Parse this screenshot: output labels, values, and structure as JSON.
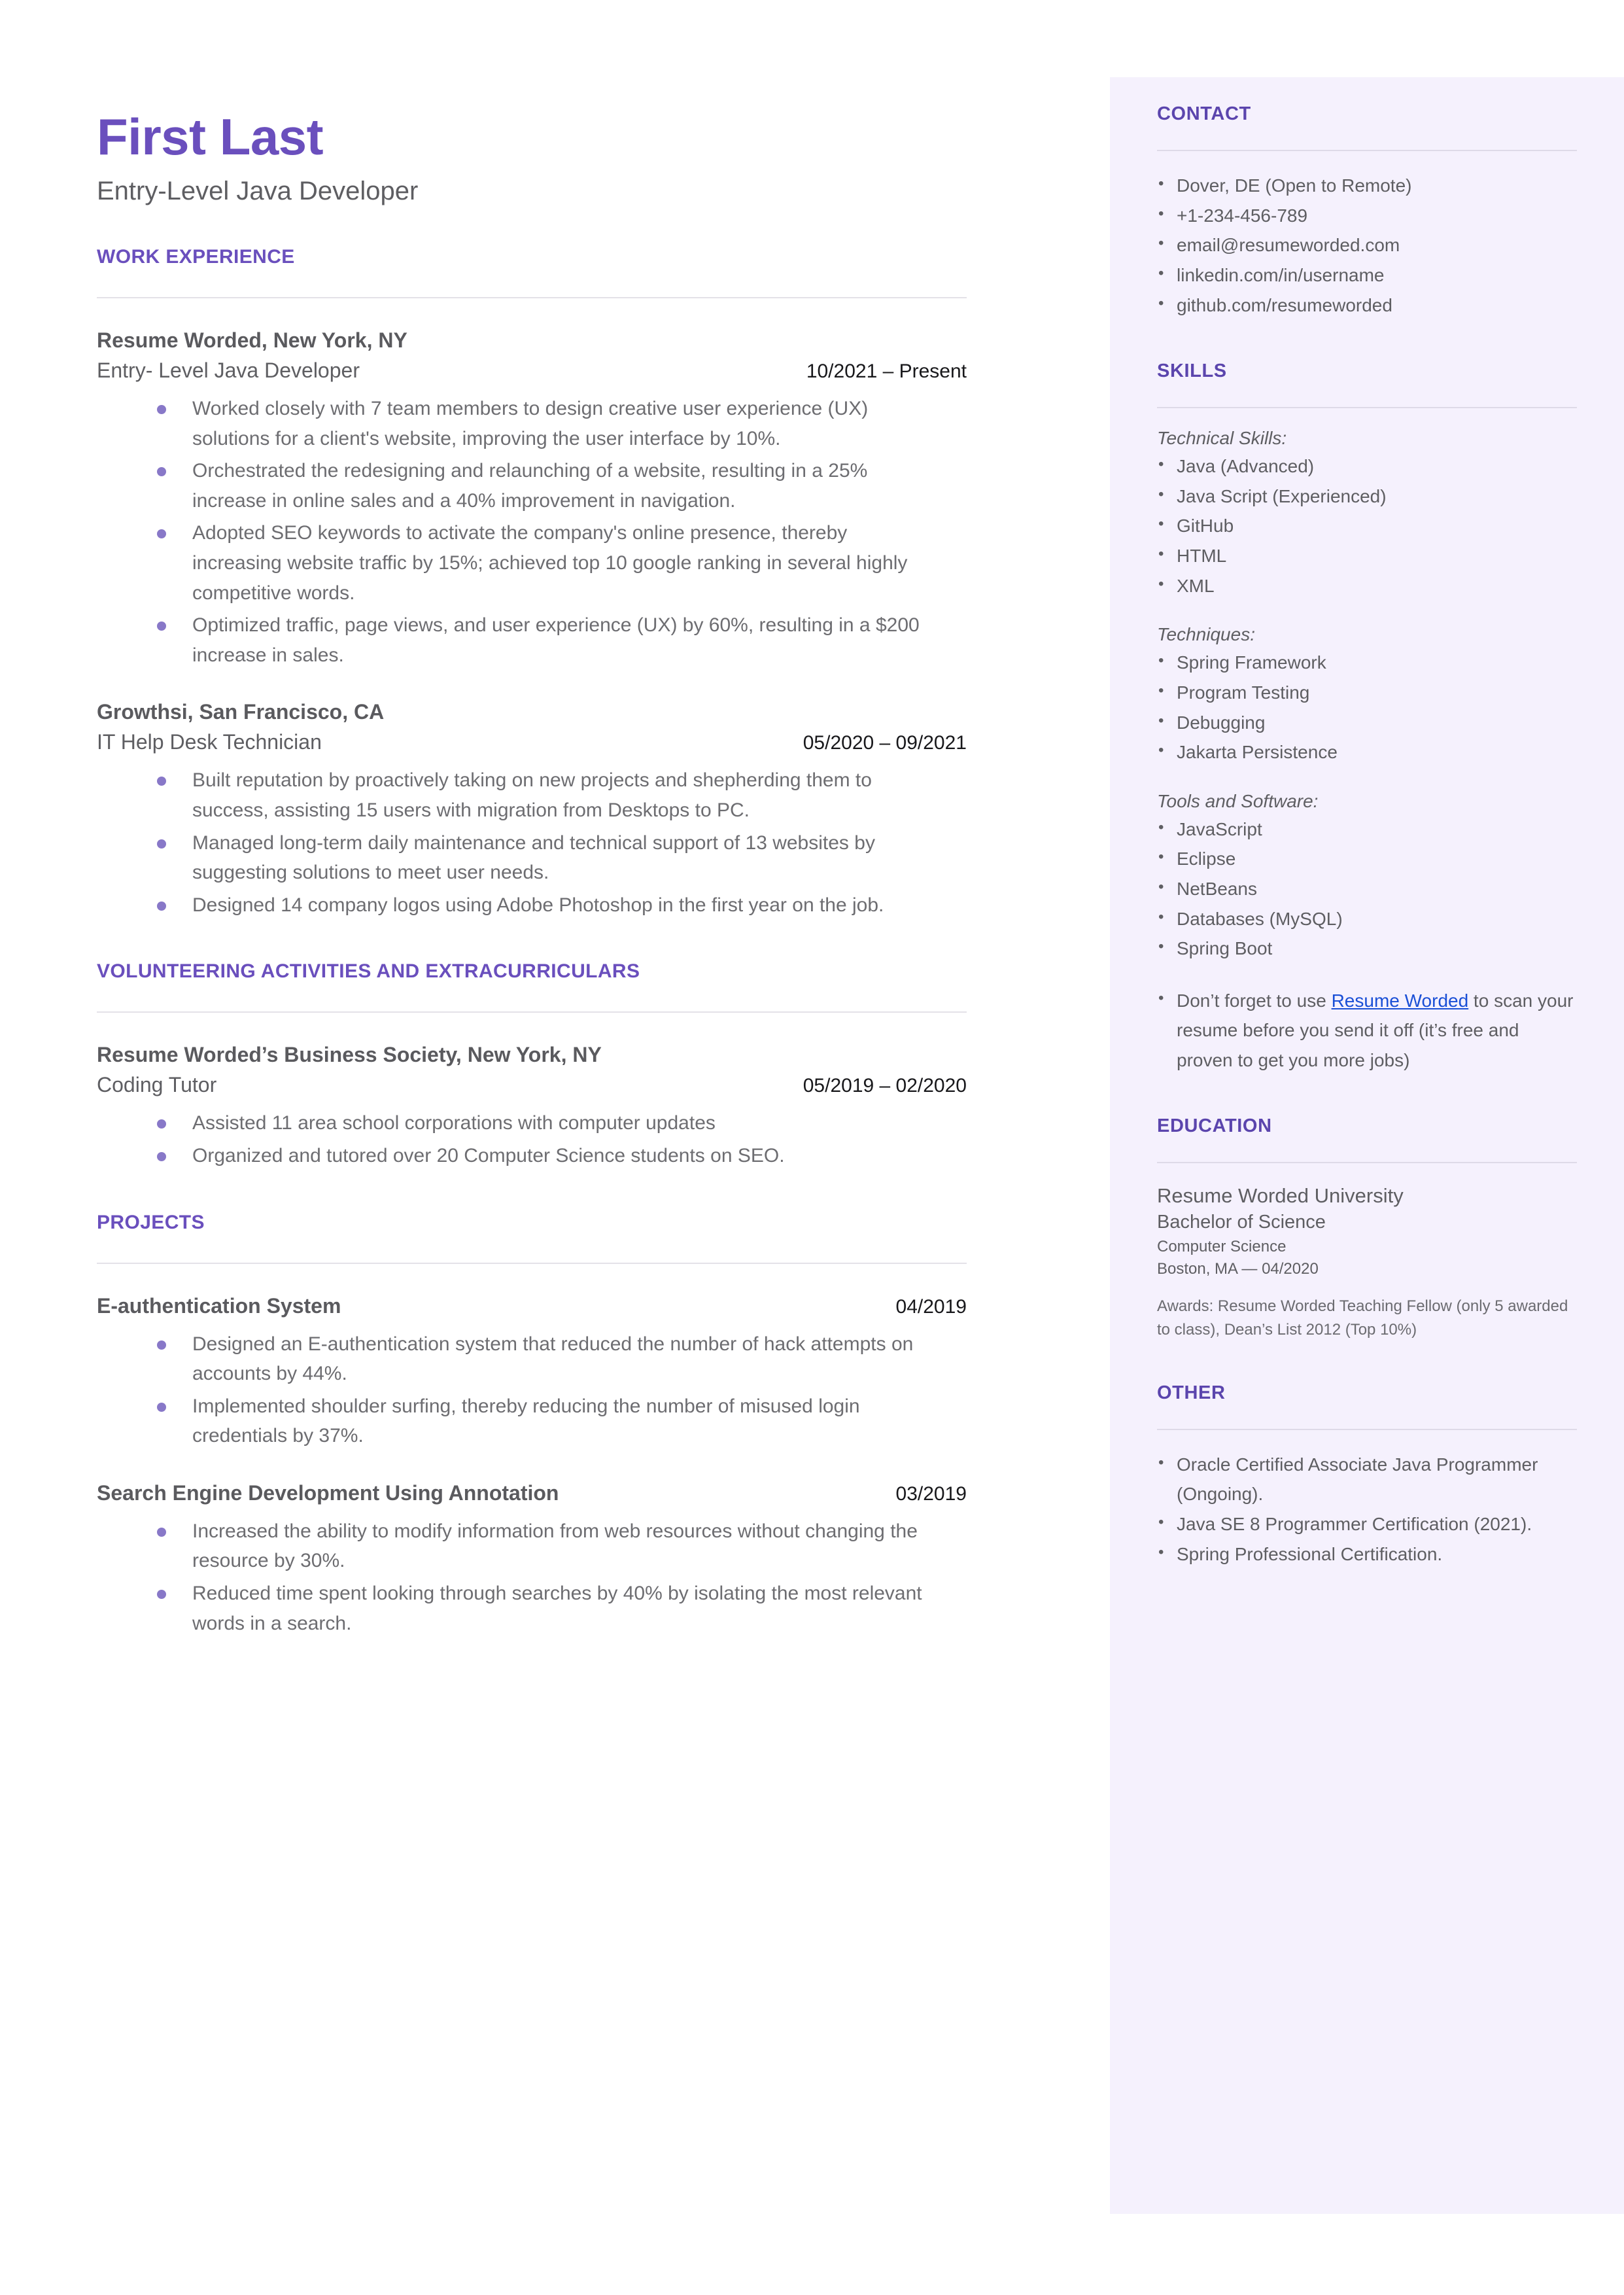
{
  "theme": {
    "accent_purple": "#6a4fbd",
    "sidebar_bg": "#f5f1fd",
    "bullet_purple": "#8878c8",
    "link_blue": "#1a4fd6",
    "body_gray": "#5e5e62"
  },
  "header": {
    "name": "First Last",
    "subtitle": "Entry-Level Java Developer"
  },
  "sections": {
    "work_experience_heading": "WORK EXPERIENCE",
    "volunteering_heading": "VOLUNTEERING ACTIVITIES AND EXTRACURRICULARS",
    "projects_heading": "PROJECTS"
  },
  "work_experience": [
    {
      "org": "Resume Worded, New York, NY",
      "title": "Entry- Level Java Developer",
      "date": "10/2021 – Present",
      "bullets": [
        "Worked closely with 7 team members to design creative user experience (UX) solutions for a client's website, improving the user interface by 10%.",
        "Orchestrated the redesigning and relaunching of a website, resulting in a 25% increase in online sales and a 40% improvement in navigation.",
        "Adopted SEO keywords to activate the company's online presence, thereby increasing website traffic by 15%; achieved top 10 google ranking in several highly competitive words.",
        "Optimized traffic, page views, and user experience (UX) by 60%, resulting in a $200 increase in sales."
      ]
    },
    {
      "org": "Growthsi, San Francisco, CA",
      "title": "IT Help Desk Technician",
      "date": "05/2020 – 09/2021",
      "bullets": [
        "Built reputation by proactively taking on new projects and shepherding them to success, assisting 15 users with migration from Desktops to PC.",
        "Managed long-term daily maintenance and technical support of 13 websites by suggesting solutions to meet user needs.",
        "Designed 14 company logos using Adobe Photoshop in the first year on the job."
      ]
    }
  ],
  "volunteering": [
    {
      "org": "Resume Worded’s Business Society, New York, NY",
      "title": "Coding Tutor",
      "date": "05/2019 – 02/2020",
      "bullets": [
        "Assisted 11 area school corporations with computer updates",
        "Organized and tutored over 20 Computer Science students on SEO."
      ]
    }
  ],
  "projects": [
    {
      "name": "E-authentication System",
      "date": "04/2019",
      "bullets": [
        "Designed an E-authentication system that reduced the number of hack attempts on accounts by 44%.",
        "Implemented shoulder surfing, thereby reducing the number of misused login credentials by 37%."
      ]
    },
    {
      "name": "Search Engine Development Using Annotation",
      "date": "03/2019",
      "bullets": [
        "Increased the ability to modify information from web resources without changing the resource by 30%.",
        "Reduced time spent looking through searches by 40% by isolating the most relevant words in a search."
      ]
    }
  ],
  "sidebar": {
    "contact": {
      "heading": "CONTACT",
      "items": [
        " Dover, DE (Open to Remote)",
        "+1-234-456-789",
        "email@resumeworded.com",
        "linkedin.com/in/username",
        "github.com/resumeworded"
      ]
    },
    "skills": {
      "heading": "SKILLS",
      "groups": [
        {
          "label": "Technical Skills:",
          "items": [
            " Java (Advanced)",
            " Java Script (Experienced)",
            " GitHub",
            " HTML",
            " XML"
          ]
        },
        {
          "label": "Techniques:",
          "items": [
            " Spring Framework",
            " Program Testing",
            " Debugging",
            " Jakarta Persistence"
          ]
        },
        {
          "label": "Tools and Software:",
          "items": [
            " JavaScript",
            " Eclipse",
            " NetBeans",
            " Databases (MySQL)",
            " Spring Boot"
          ]
        }
      ],
      "promo": {
        "before": " Don’t forget to use ",
        "link": "Resume Worded",
        "after": " to scan your resume before you send it off (it’s free and proven to get you more jobs)"
      }
    },
    "education": {
      "heading": "EDUCATION",
      "school": "Resume Worded University",
      "degree": "Bachelor of Science",
      "major": "Computer Science",
      "location": "Boston, MA — 04/2020",
      "awards": "Awards: Resume Worded Teaching Fellow (only 5 awarded to class), Dean’s List 2012 (Top 10%)"
    },
    "other": {
      "heading": "OTHER",
      "items": [
        " Oracle Certified Associate Java Programmer (Ongoing).",
        " Java SE 8 Programmer Certification (2021).",
        " Spring Professional Certification."
      ]
    }
  }
}
